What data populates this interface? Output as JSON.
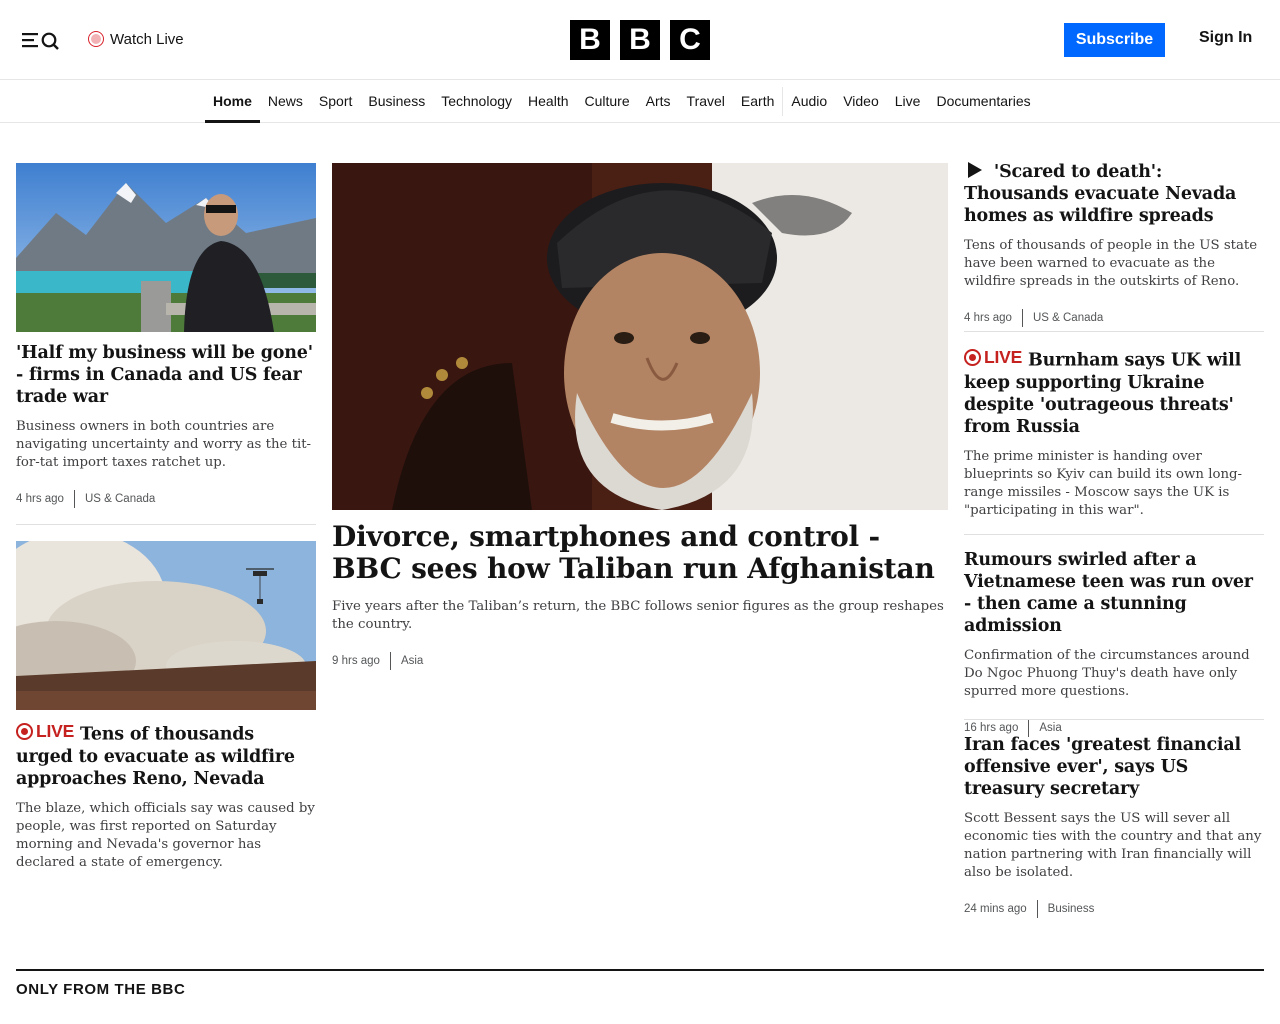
{
  "header": {
    "watch_live": "Watch Live",
    "logo_letters": [
      "B",
      "B",
      "C"
    ],
    "subscribe": "Subscribe",
    "sign_in": "Sign In",
    "brand_blue": "#0068ff"
  },
  "nav": {
    "items": [
      "Home",
      "News",
      "Sport",
      "Business",
      "Technology",
      "Health",
      "Culture",
      "Arts",
      "Travel",
      "Earth",
      "Audio",
      "Video",
      "Live",
      "Documentaries"
    ],
    "active": "Home"
  },
  "left": {
    "story1": {
      "headline": "'Half my business will be gone' - firms in Canada and US fear trade war",
      "summary": "Business owners in both countries are navigating uncertainty and worry as the tit-for-tat import taxes ratchet up.",
      "time": "4 hrs ago",
      "section": "US & Canada"
    },
    "story2": {
      "live_label": "LIVE",
      "headline": "Tens of thousands urged to evacuate as wildfire approaches Reno, Nevada",
      "summary": "The blaze, which officials say was caused by people, was first reported on Saturday morning and Nevada's governor has declared a state of emergency."
    }
  },
  "center": {
    "headline": "Divorce, smartphones and control - BBC sees how Taliban run Afghanistan",
    "summary": "Five years after the Taliban’s return, the BBC follows senior figures as the group reshapes the country.",
    "time": "9 hrs ago",
    "section": "Asia"
  },
  "right": {
    "story1": {
      "headline": "'Scared to death': Thousands evacuate Nevada homes as wildfire spreads",
      "summary": "Tens of thousands of people in the US state have been warned to evacuate as the wildfire spreads in the outskirts of Reno.",
      "time": "4 hrs ago",
      "section": "US & Canada"
    },
    "story2": {
      "live_label": "LIVE",
      "headline": "Burnham says UK will keep supporting Ukraine despite 'outrageous threats' from Russia",
      "summary": "The prime minister is handing over blueprints so Kyiv can build its own long-range missiles - Moscow says the UK is \"participating in this war\"."
    },
    "story3": {
      "headline": "Rumours swirled after a Vietnamese teen was run over - then came a stunning admission",
      "summary": "Confirmation of the circumstances around Do Ngoc Phuong Thuy's death have only spurred more questions.",
      "time": "16 hrs ago",
      "section": "Asia"
    },
    "story4": {
      "headline": "Iran faces 'greatest financial offensive ever', says US treasury secretary",
      "summary": "Scott Bessent says the US will sever all economic ties with the country and that any nation partnering with Iran financially will also be isolated.",
      "time": "24 mins ago",
      "section": "Business"
    }
  },
  "only_from_bbc": "ONLY FROM THE BBC",
  "icons": {
    "menu": "menu-icon",
    "search": "search-icon",
    "live": "live-dot-icon",
    "play": "play-icon"
  }
}
